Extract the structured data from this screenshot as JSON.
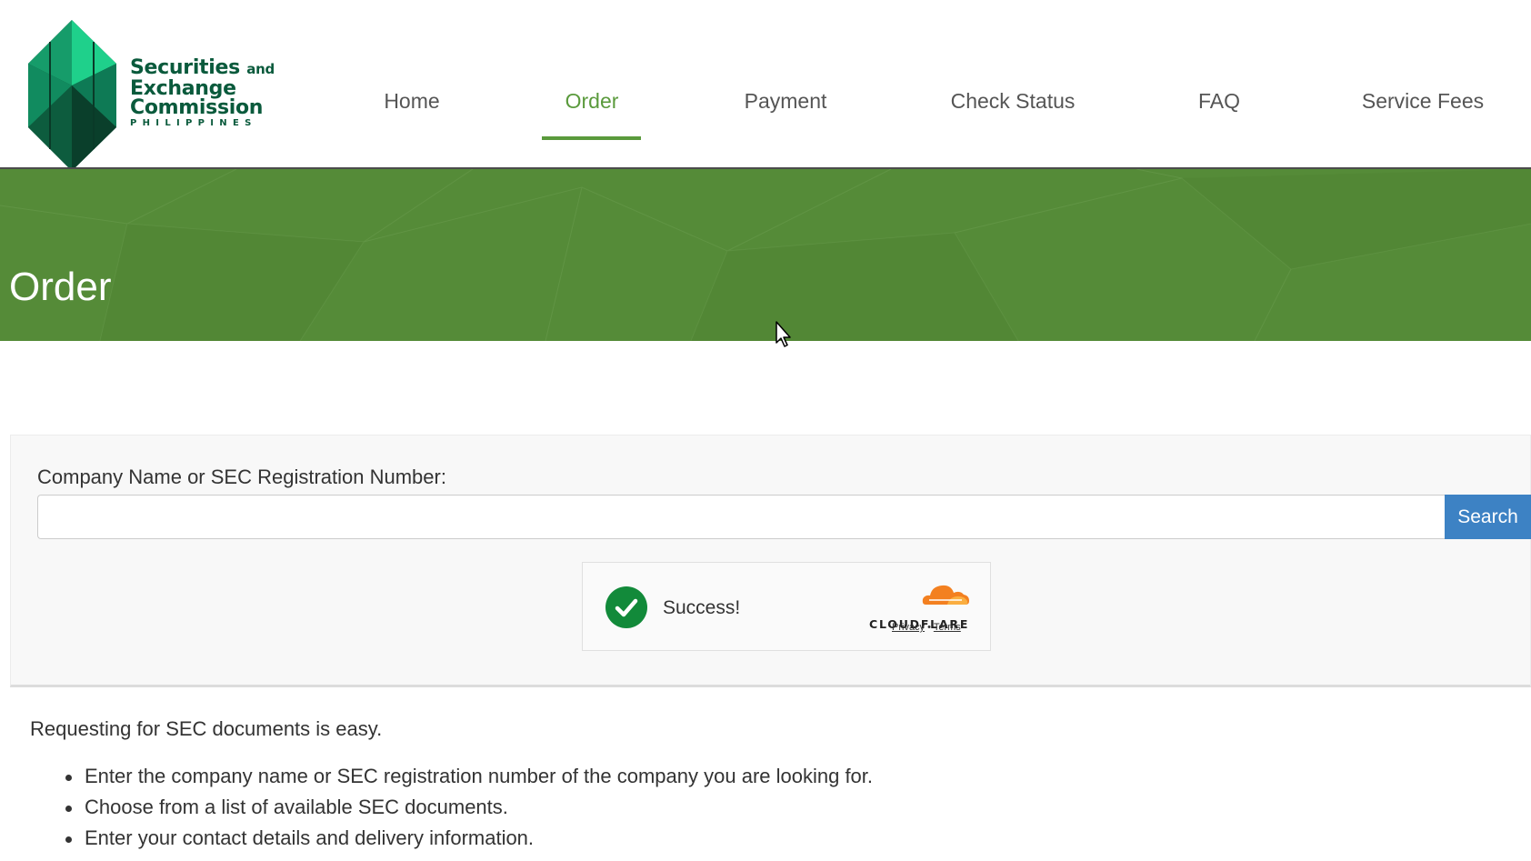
{
  "header": {
    "logo": {
      "line1": "Securities",
      "and": "and",
      "line2": "Exchange",
      "line3": "Commission",
      "sub": "PHILIPPINES"
    },
    "nav": [
      {
        "label": "Home"
      },
      {
        "label": "Order",
        "active": true
      },
      {
        "label": "Payment"
      },
      {
        "label": "Check Status"
      },
      {
        "label": "FAQ"
      },
      {
        "label": "Service Fees"
      }
    ]
  },
  "banner": {
    "title": "Order"
  },
  "search": {
    "label": "Company Name or SEC Registration Number:",
    "value": "",
    "placeholder": "",
    "button_label": "Search"
  },
  "captcha": {
    "status": "Success!",
    "brand": "CLOUDFLARE",
    "privacy_link": "Privacy",
    "separator": "•",
    "terms_link": "Terms"
  },
  "instructions": {
    "intro": "Requesting for SEC documents is easy.",
    "steps": [
      "Enter the company name or SEC registration number of the company you are looking for.",
      "Choose from a list of available SEC documents.",
      "Enter your contact details and delivery information."
    ]
  },
  "colors": {
    "brand_green": "#5a9a3c",
    "banner_green": "#558b38",
    "logo_green": "#0a5a3c",
    "button_blue": "#3d82c4",
    "success_green": "#128a3a",
    "cloudflare_orange": "#f38020"
  },
  "icons": {
    "check": "checkmark-icon",
    "cloud": "cloudflare-cloud-icon",
    "cursor": "mouse-pointer-icon"
  }
}
